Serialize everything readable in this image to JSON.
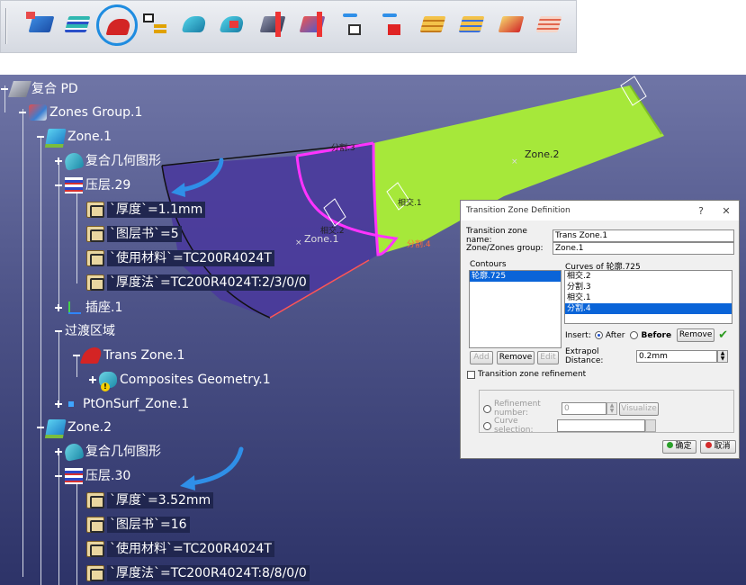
{
  "toolbar": {
    "icons": [
      "composites-parameters-icon",
      "plies-table-icon",
      "transition-zone-icon",
      "stacking-icon",
      "zone-icon",
      "zone-group-icon",
      "geometry-icon",
      "zone-edit-icon",
      "ply-transfer-icon",
      "ply-transfer-alt-icon",
      "solid-from-zone-icon",
      "solid-slice-icon",
      "solid-red-icon",
      "solid-pink-icon"
    ],
    "active_index": 2
  },
  "tree": {
    "root": "复合 PD",
    "zones_group": "Zones Group.1",
    "zone1": {
      "label": "Zone.1",
      "geometry": "复合几何图形",
      "plies": "压层.29",
      "params": [
        "`厚度`=1.1mm",
        "`图层书`=5",
        "`使用材料`=TC200R4024T",
        "`厚度法`=TC200R4024T:2/3/0/0"
      ],
      "socket": "插座.1"
    },
    "transition_area": "过渡区域",
    "trans_zone": "Trans Zone.1",
    "composites_geometry": "Composites Geometry.1",
    "pt_on_surf": "PtOnSurf_Zone.1",
    "zone2": {
      "label": "Zone.2",
      "geometry": "复合几何图形",
      "plies": "压层.30",
      "params": [
        "`厚度`=3.52mm",
        "`图层书`=16",
        "`使用材料`=TC200R4024T",
        "`厚度法`=TC200R4024T:8/8/0/0"
      ]
    }
  },
  "scene": {
    "labels": {
      "zone2": "Zone.2",
      "zone1": "Zone.1",
      "split3": "分割.3",
      "inter1": "相交.1",
      "inter2": "相交.2",
      "split4": "分割.4"
    },
    "colors": {
      "zone1_fill": "#4a3a9c",
      "zone2_fill": "#a6e83a",
      "contour": "#ff33ff",
      "accent_arrow": "#2f8fe8"
    }
  },
  "dialog": {
    "title": "Transition Zone Definition",
    "help": "?",
    "close": "✕",
    "name_label": "Transition zone name:",
    "name_value": "Trans Zone.1",
    "group_label": "Zone/Zones group:",
    "group_value": "Zone.1",
    "contours_label": "Contours",
    "contours": [
      "轮廓.725"
    ],
    "curves_label": "Curves of 轮廓.725",
    "curves": [
      "相交.2",
      "分割.3",
      "相交.1",
      "分割.4"
    ],
    "curves_selected": 3,
    "add": "Add",
    "remove_left": "Remove",
    "edit": "Edit",
    "insert_label": "Insert:",
    "after": "After",
    "before": "Before",
    "remove_right": "Remove",
    "extrapol_label": "Extrapol Distance:",
    "extrapol_value": "0.2mm",
    "refinement": "Transition zone refinement",
    "refinement_number_label": "Refinement number:",
    "refinement_number_value": "0",
    "visualize": "Visualize",
    "curve_selection_label": "Curve selection:",
    "ok": "确定",
    "cancel": "取消"
  }
}
